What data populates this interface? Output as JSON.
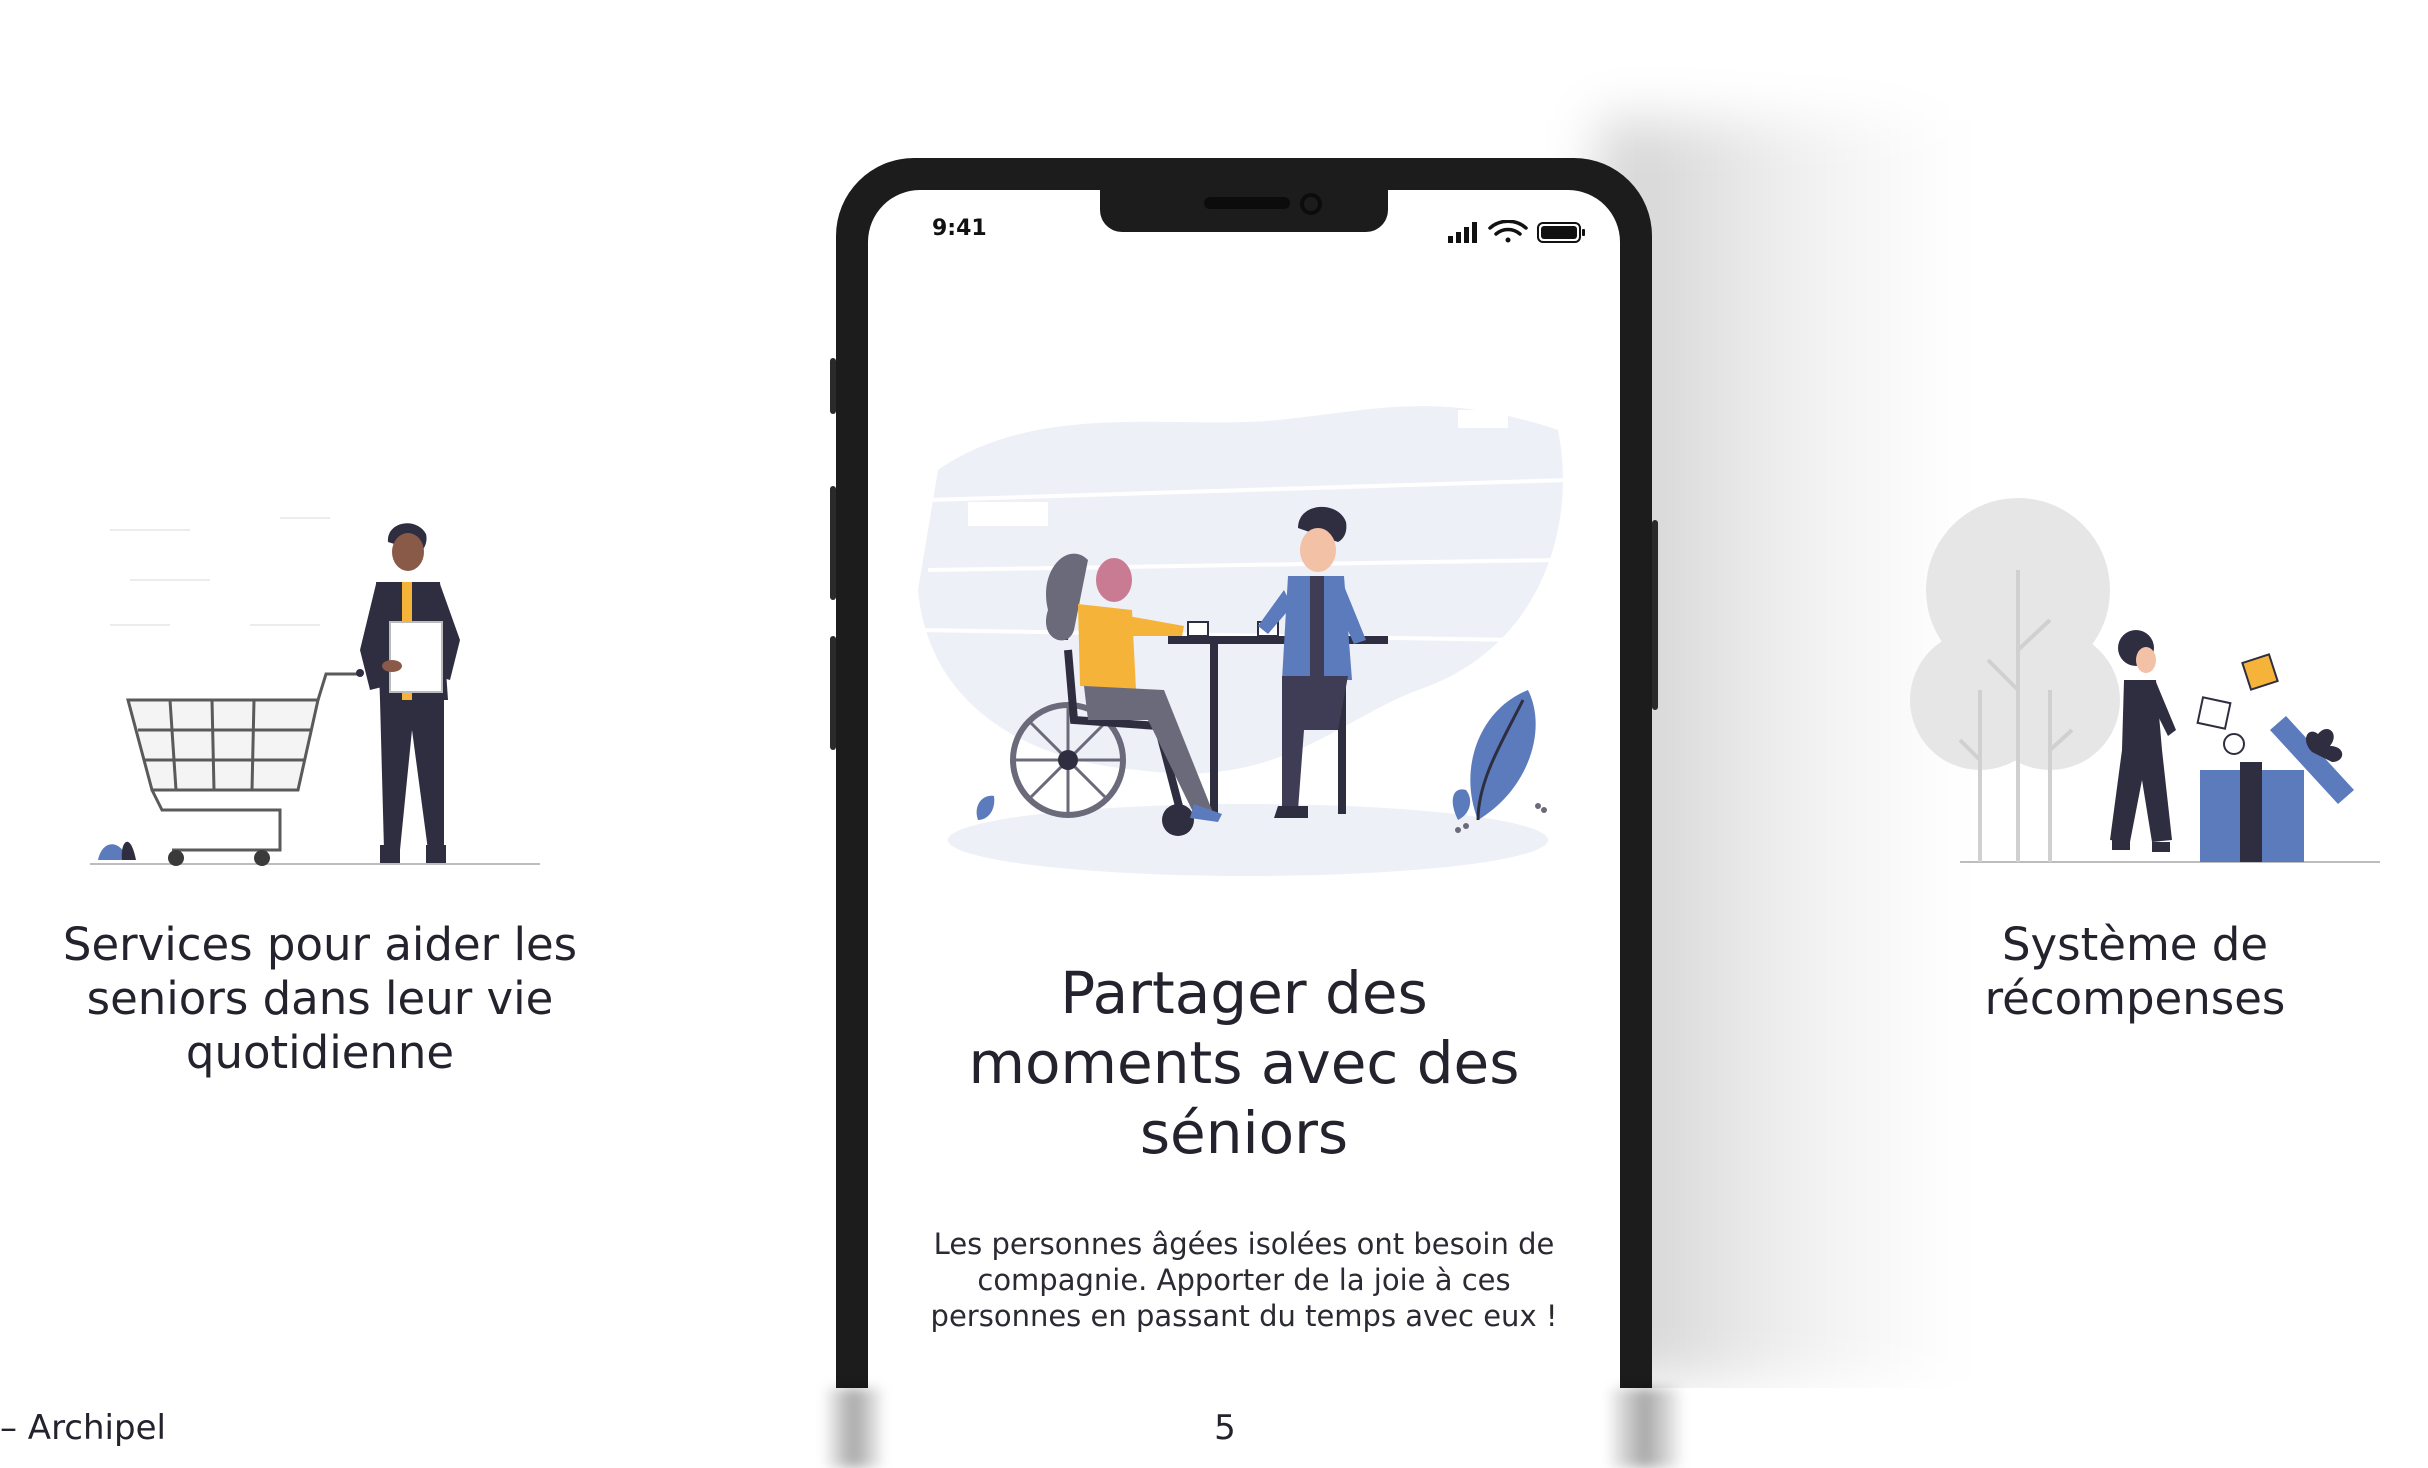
{
  "phone": {
    "status_time": "9:41",
    "headline": "Partager des moments avec des séniors",
    "body": "Les personnes âgées isolées ont besoin de compagnie. Apporter de la joie à ces personnes en passant du temps avec eux !"
  },
  "features": {
    "left_text": "Services pour aider les seniors dans leur vie quotidienne",
    "right_text": "Système de récompenses"
  },
  "footer": {
    "left": "– Archipel",
    "page_number": "5"
  },
  "colors": {
    "accent_blue": "#5b7bbd",
    "accent_yellow": "#f6b33a",
    "dark": "#2f2e41",
    "bg_blob": "#eef0f8"
  },
  "icons": [
    "signal-icon",
    "wifi-icon",
    "battery-icon"
  ]
}
